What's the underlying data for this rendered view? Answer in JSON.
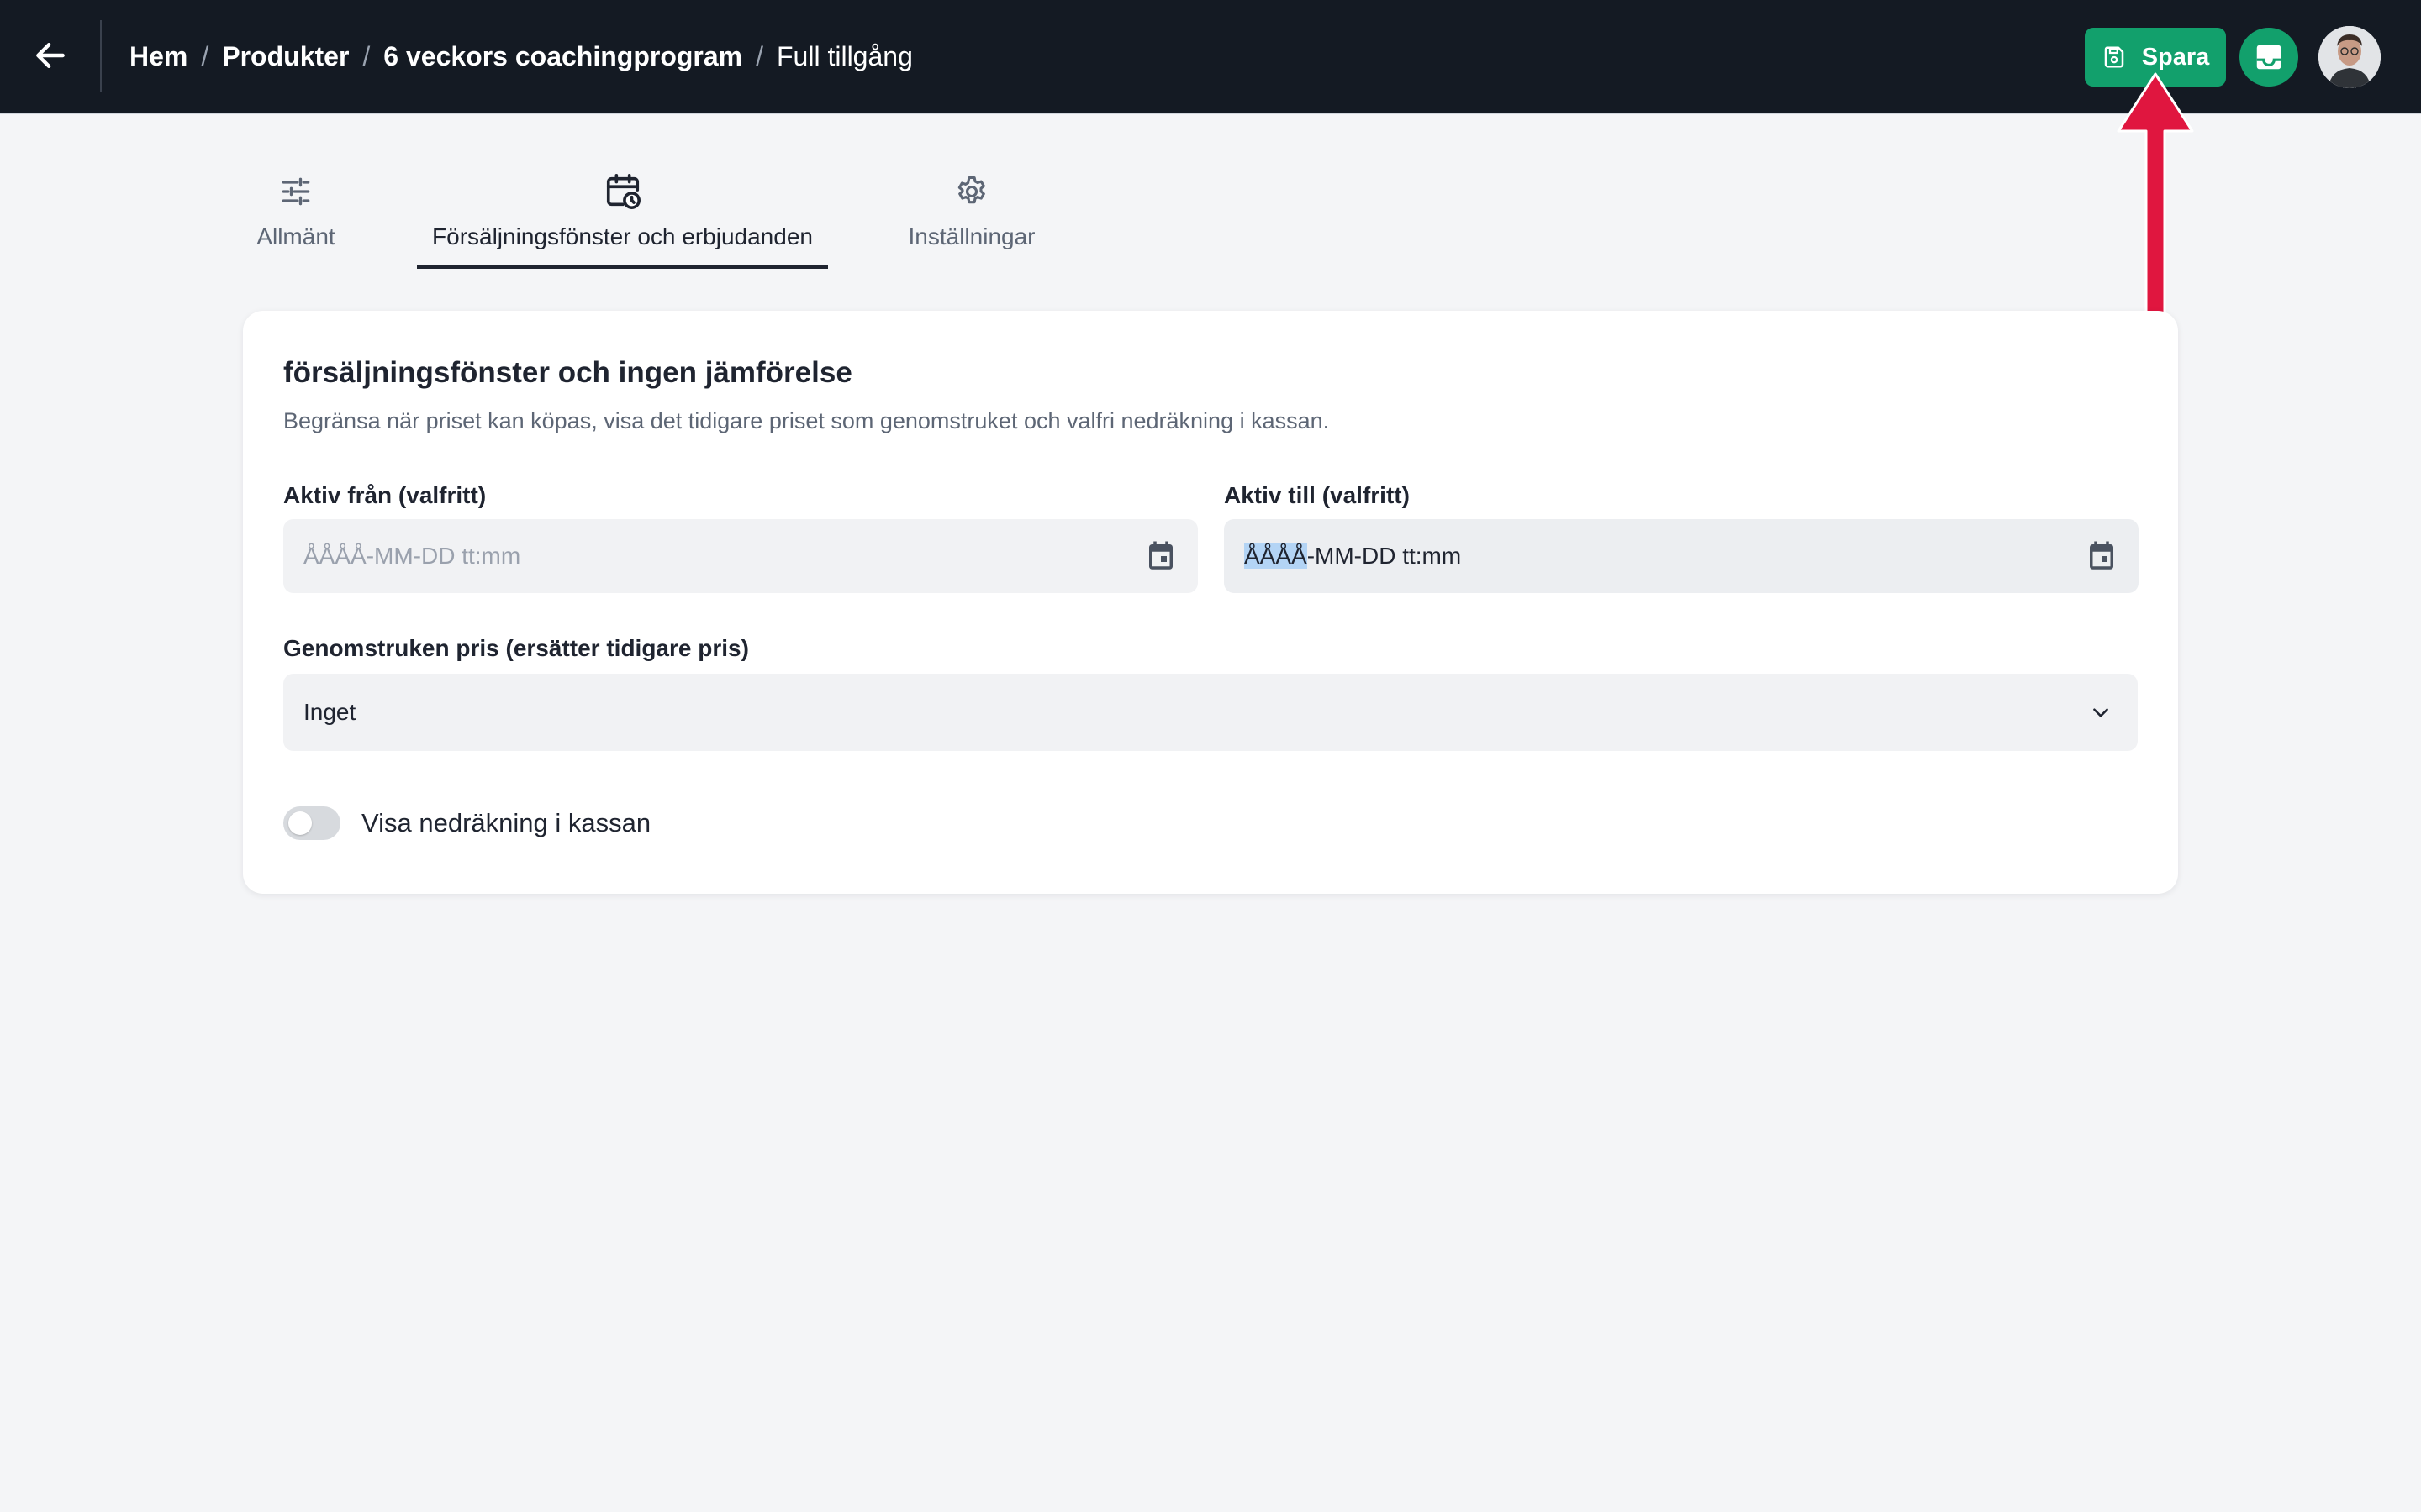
{
  "header": {
    "back_icon": "arrow-left-icon",
    "breadcrumb": [
      {
        "label": "Hem"
      },
      {
        "label": "Produkter"
      },
      {
        "label": "6 veckors coachingprogram"
      }
    ],
    "breadcrumb_separator": "/",
    "current": "Full tillgång",
    "save_label": "Spara",
    "save_icon": "floppy-disk-icon",
    "inbox_icon": "inbox-icon",
    "avatar_icon": "user-avatar",
    "colors": {
      "bar_background": "#141a23",
      "save_button": "#12a06c",
      "annotation_arrow": "#e0163f"
    }
  },
  "tabs": [
    {
      "label": "Allmänt",
      "icon": "sliders-icon",
      "active": false
    },
    {
      "label": "Försäljningsfönster och erbjudanden",
      "icon": "calendar-clock-icon",
      "active": true
    },
    {
      "label": "Inställningar",
      "icon": "gear-icon",
      "active": false
    }
  ],
  "card": {
    "title": "försäljningsfönster och ingen jämförelse",
    "description": "Begränsa när priset kan köpas, visa det tidigare priset som genomstruket och valfri nedräkning i kassan.",
    "active_from": {
      "label": "Aktiv från (valfritt)",
      "placeholder": "ÅÅÅÅ-MM-DD tt:mm",
      "icon": "calendar-icon"
    },
    "active_to": {
      "label": "Aktiv till (valfritt)",
      "selected_part": "ÅÅÅÅ",
      "rest_part": "-MM-DD tt:mm",
      "icon": "calendar-icon"
    },
    "strike_price": {
      "label": "Genomstruken pris (ersätter tidigare pris)",
      "value": "Inget",
      "icon": "chevron-down-icon"
    },
    "countdown": {
      "label": "Visa nedräkning i kassan",
      "enabled": false
    }
  }
}
